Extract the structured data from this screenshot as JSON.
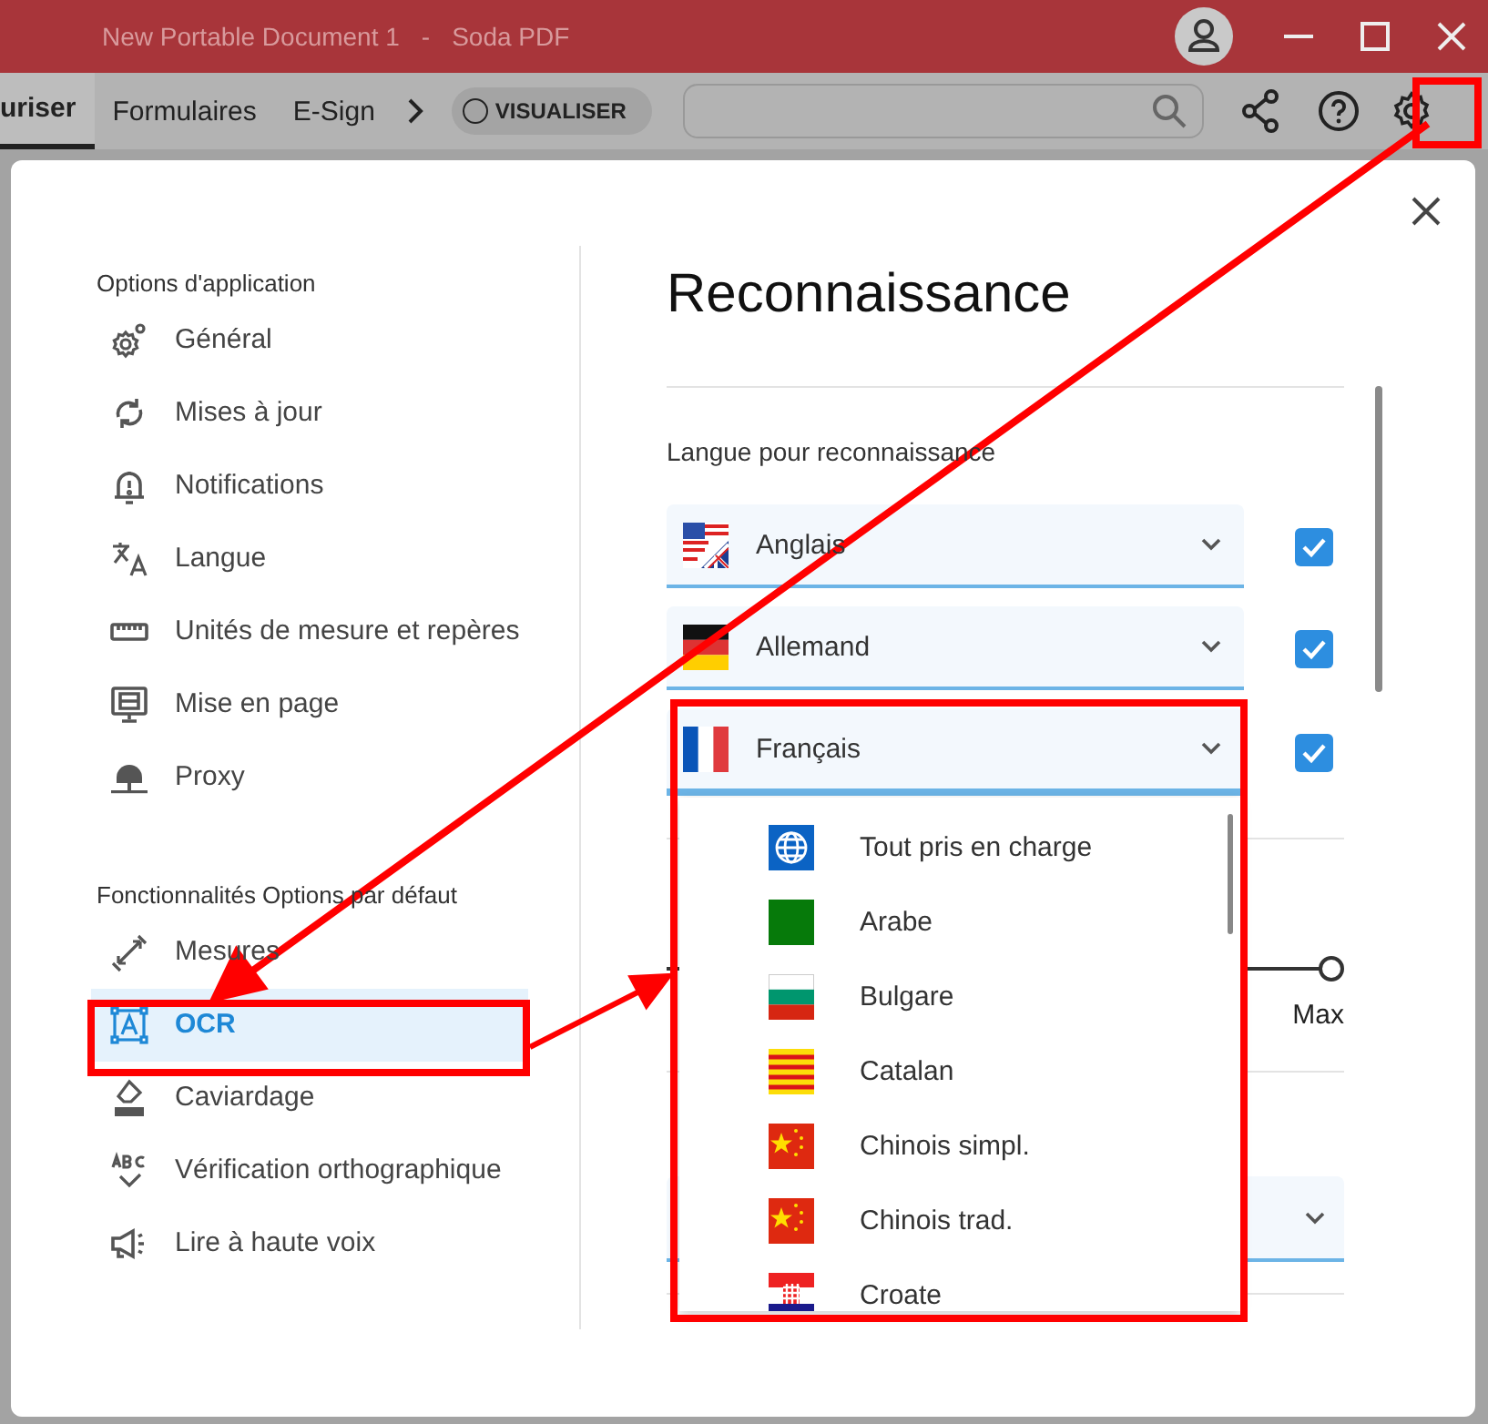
{
  "window": {
    "title": "New Portable Document 1",
    "separator": "-",
    "app_name": "Soda PDF"
  },
  "toolbar": {
    "tabs": [
      {
        "label": "uriser",
        "selected": true
      },
      {
        "label": "Formulaires",
        "selected": false
      },
      {
        "label": "E-Sign",
        "selected": false
      }
    ],
    "view_toggle": {
      "label": "VISUALISER",
      "on": false
    }
  },
  "sidebar": {
    "sections": [
      {
        "heading": "Options d'application",
        "items": [
          {
            "label": "Général",
            "selected": false
          },
          {
            "label": "Mises à jour",
            "selected": false
          },
          {
            "label": "Notifications",
            "selected": false
          },
          {
            "label": "Langue",
            "selected": false
          },
          {
            "label": "Unités de mesure et repères",
            "selected": false
          },
          {
            "label": "Mise en page",
            "selected": false
          },
          {
            "label": "Proxy",
            "selected": false
          }
        ]
      },
      {
        "heading": "Fonctionnalités Options par défaut",
        "items": [
          {
            "label": "Mesures",
            "selected": false
          },
          {
            "label": "OCR",
            "selected": true
          },
          {
            "label": "Caviardage",
            "selected": false
          },
          {
            "label": "Vérification orthographique",
            "selected": false
          },
          {
            "label": "Lire à haute voix",
            "selected": false
          }
        ]
      }
    ]
  },
  "panel": {
    "title": "Reconnaissance",
    "language_label": "Langue pour reconnaissance",
    "languages": [
      {
        "label": "Anglais",
        "checked": true,
        "expanded": false
      },
      {
        "label": "Allemand",
        "checked": true,
        "expanded": false
      },
      {
        "label": "Français",
        "checked": true,
        "expanded": true
      }
    ],
    "dropdown_options": [
      {
        "label": "Tout pris en charge"
      },
      {
        "label": "Arabe"
      },
      {
        "label": "Bulgare"
      },
      {
        "label": "Catalan"
      },
      {
        "label": "Chinois simpl."
      },
      {
        "label": "Chinois trad."
      },
      {
        "label": "Croate"
      }
    ],
    "slider": {
      "max_label": "Max",
      "level": 1
    }
  }
}
